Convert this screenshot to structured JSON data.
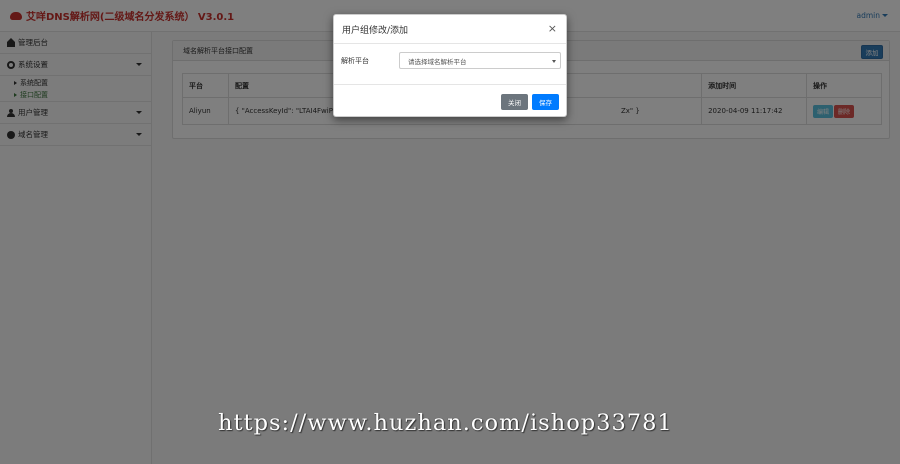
{
  "app": {
    "title": "艾咩DNS解析网(二级域名分发系统） V3.0.1",
    "user": "admin"
  },
  "sidebar": {
    "items": [
      {
        "label": "管理后台",
        "icon": "home-icon"
      },
      {
        "label": "系统设置",
        "icon": "gear-icon",
        "children": [
          {
            "label": "系统配置"
          },
          {
            "label": "接口配置",
            "active": true
          }
        ]
      },
      {
        "label": "用户管理",
        "icon": "user-icon"
      },
      {
        "label": "域名管理",
        "icon": "globe-icon"
      }
    ]
  },
  "main": {
    "panel_title": "域名解析平台接口配置",
    "add_label": "添加",
    "table": {
      "headers": [
        "平台",
        "配置",
        "添加时间",
        "操作"
      ],
      "rows": [
        {
          "platform": "Aliyun",
          "config_start": "{ \"AccessKeyId\": \"LTAI4FwiPrHV",
          "config_end": "Zx\" }",
          "added": "2020-04-09 11:17:42",
          "edit_label": "编辑",
          "delete_label": "删除"
        }
      ]
    }
  },
  "modal": {
    "title": "用户组修改/添加",
    "close_glyph": "×",
    "field_label": "解析平台",
    "select_value": "请选择域名解析平台",
    "close_label": "关闭",
    "save_label": "保存"
  },
  "watermark": "https://www.huzhan.com/ishop33781",
  "colors": {
    "brand": "#c9302c",
    "primary": "#007bff",
    "secondary": "#6c757d",
    "info": "#5bc0de",
    "danger": "#d9534f"
  }
}
